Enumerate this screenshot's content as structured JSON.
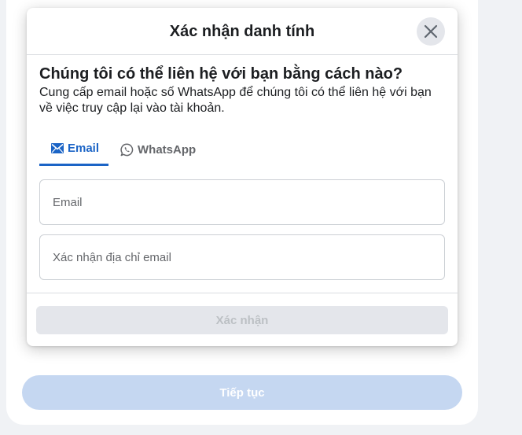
{
  "background": {
    "continue_label": "Tiếp tục"
  },
  "modal": {
    "title": "Xác nhận danh tính",
    "close_icon": "close-icon",
    "question": "Chúng tôi có thể liên hệ với bạn bằng cách nào?",
    "description": "Cung cấp email hoặc số WhatsApp để chúng tôi có thể liên hệ với bạn về việc truy cập lại vào tài khoản.",
    "tabs": [
      {
        "label": "Email",
        "icon": "envelope-icon",
        "active": true
      },
      {
        "label": "WhatsApp",
        "icon": "whatsapp-icon",
        "active": false
      }
    ],
    "fields": {
      "email": {
        "placeholder": "Email",
        "value": ""
      },
      "confirm_email": {
        "placeholder": "Xác nhận địa chỉ email",
        "value": ""
      }
    },
    "confirm_label": "Xác nhận"
  },
  "colors": {
    "accent": "#1b64c6",
    "disabled_button_bg": "#e4e6eb",
    "disabled_button_text": "#bcc0c4",
    "continue_button_bg": "#c5d7f1"
  }
}
